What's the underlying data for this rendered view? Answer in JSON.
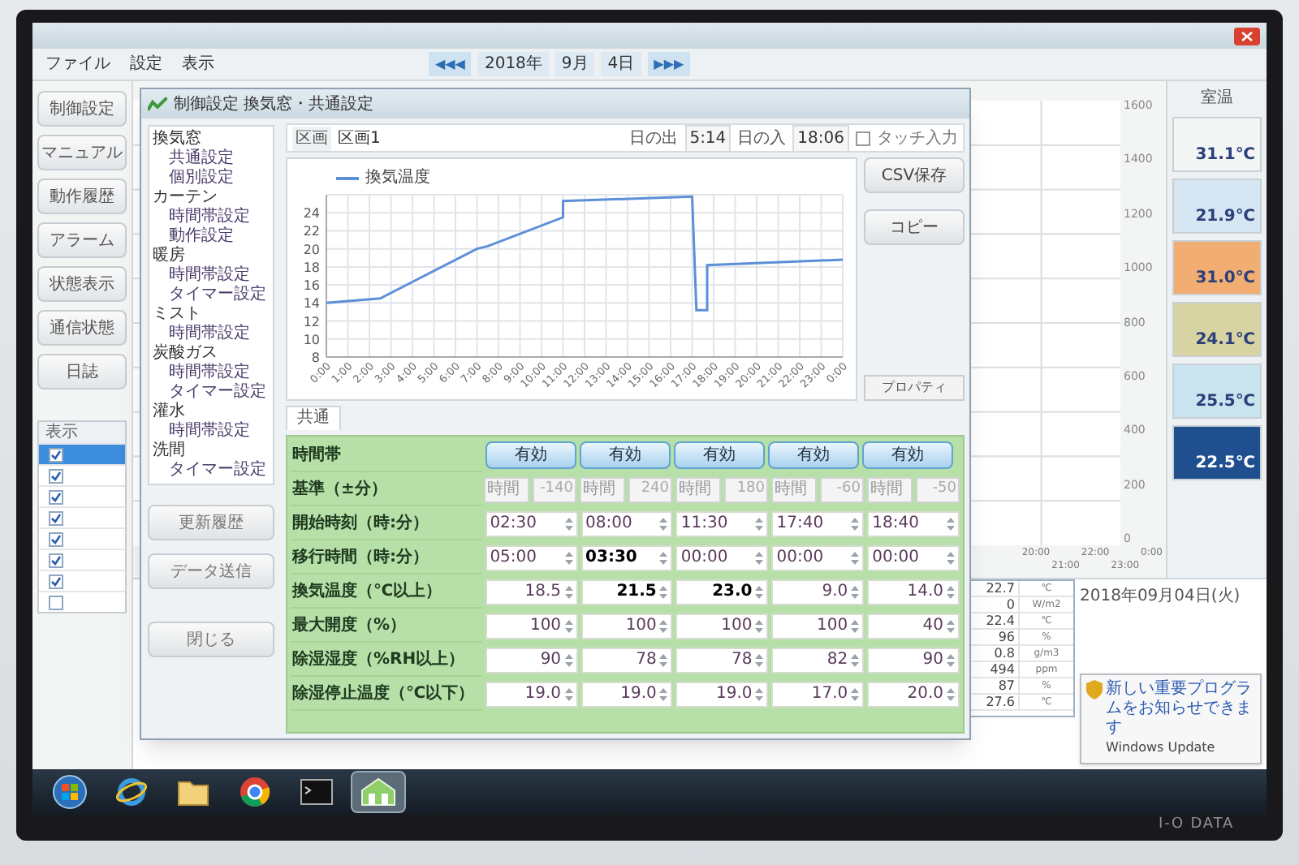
{
  "monitor": {
    "brand": "I-O DATA"
  },
  "app": {
    "menu": [
      "ファイル",
      "設定",
      "表示"
    ],
    "date_nav": {
      "prev": "◀◀◀",
      "year": "2018年",
      "month": "9月",
      "day": "4日",
      "next": "▶▶▶"
    },
    "nav_buttons": [
      "制御設定",
      "マニュアル",
      "動作履歴",
      "アラーム",
      "状態表示",
      "通信状態",
      "日誌"
    ],
    "display_list": {
      "header": "表示",
      "items": [
        {
          "checked": true,
          "selected": true
        },
        {
          "checked": true,
          "selected": false
        },
        {
          "checked": true,
          "selected": false
        },
        {
          "checked": true,
          "selected": false
        },
        {
          "checked": true,
          "selected": false
        },
        {
          "checked": true,
          "selected": false
        },
        {
          "checked": true,
          "selected": false
        },
        {
          "checked": false,
          "selected": false
        }
      ]
    },
    "trend_axis": {
      "y_labels": [
        "1600",
        "1400",
        "1200",
        "1000",
        "800",
        "600",
        "400",
        "200",
        "0"
      ],
      "x_labels": [
        "20:00",
        "21:00",
        "22:00",
        "23:00",
        "0:00"
      ]
    },
    "sensors": {
      "title": "室温",
      "items": [
        {
          "value": "31.1℃",
          "color": "#f4f6f6"
        },
        {
          "value": "21.9℃",
          "color": "#d6e6f3"
        },
        {
          "value": "31.0℃",
          "color": "#f2ae72"
        },
        {
          "value": "24.1℃",
          "color": "#d8d3a3"
        },
        {
          "value": "25.5℃",
          "color": "#c9e4ee"
        },
        {
          "value": "22.5℃",
          "color": "#1f4f8f"
        }
      ]
    },
    "readings": [
      {
        "value": "22.7",
        "unit": "℃"
      },
      {
        "value": "0",
        "unit": "W/m2"
      },
      {
        "value": "22.4",
        "unit": "℃"
      },
      {
        "value": "96",
        "unit": "%"
      },
      {
        "value": "0.8",
        "unit": "g/m3"
      },
      {
        "value": "494",
        "unit": "ppm"
      },
      {
        "value": "87",
        "unit": "%"
      },
      {
        "value": "27.6",
        "unit": "℃"
      }
    ],
    "log": {
      "date": "2018年09月04日(火)"
    },
    "notification": {
      "title": "新しい重要プログラムをお知らせできます",
      "body": "Windows Update"
    }
  },
  "dialog": {
    "title": "制御設定 換気窓・共通設定",
    "tree": [
      {
        "label": "換気窓",
        "children": [
          {
            "label": "共通設定"
          },
          {
            "label": "個別設定"
          }
        ]
      },
      {
        "label": "カーテン",
        "children": [
          {
            "label": "時間帯設定"
          },
          {
            "label": "動作設定"
          }
        ]
      },
      {
        "label": "暖房",
        "children": [
          {
            "label": "時間帯設定"
          },
          {
            "label": "タイマー設定"
          }
        ]
      },
      {
        "label": "ミスト",
        "children": [
          {
            "label": "時間帯設定"
          }
        ]
      },
      {
        "label": "炭酸ガス",
        "children": [
          {
            "label": "時間帯設定"
          },
          {
            "label": "タイマー設定"
          }
        ]
      },
      {
        "label": "灌水",
        "children": [
          {
            "label": "時間帯設定"
          }
        ]
      },
      {
        "label": "洗間",
        "children": [
          {
            "label": "タイマー設定"
          }
        ]
      }
    ],
    "side_buttons": [
      "更新履歴",
      "データ送信",
      "閉じる"
    ],
    "zone_label": "区画",
    "zone": "区画1",
    "sunrise_label": "日の出",
    "sunrise": "5:14",
    "sunset_label": "日の入",
    "sunset": "18:06",
    "touch_input": {
      "label": "タッチ入力",
      "checked": false
    },
    "buttons": [
      "CSV保存",
      "コピー"
    ],
    "chart_button": "プロパティ",
    "chart_data": {
      "type": "line",
      "x": [
        0,
        2.5,
        7,
        7.5,
        11,
        11,
        17,
        17.2,
        17.7,
        17.7,
        24
      ],
      "series": [
        {
          "name": "換気温度",
          "color": "#5b8fd8",
          "values": [
            14,
            14.5,
            20,
            20.3,
            23.5,
            25.3,
            25.8,
            13.2,
            13.2,
            18.2,
            18.8
          ]
        }
      ],
      "xlim": [
        0,
        24
      ],
      "ylim": [
        8,
        26
      ],
      "yticks": [
        8,
        10,
        12,
        14,
        16,
        18,
        20,
        22,
        24
      ],
      "xticks": [
        {
          "value": 0,
          "label": "0:00"
        },
        {
          "value": 1,
          "label": "1:00"
        },
        {
          "value": 2,
          "label": "2:00"
        },
        {
          "value": 3,
          "label": "3:00"
        },
        {
          "value": 4,
          "label": "4:00"
        },
        {
          "value": 5,
          "label": "5:00"
        },
        {
          "value": 6,
          "label": "6:00"
        },
        {
          "value": 7,
          "label": "7:00"
        },
        {
          "value": 8,
          "label": "8:00"
        },
        {
          "value": 9,
          "label": "9:00"
        },
        {
          "value": 10,
          "label": "10:00"
        },
        {
          "value": 11,
          "label": "11:00"
        },
        {
          "value": 12,
          "label": "12:00"
        },
        {
          "value": 13,
          "label": "13:00"
        },
        {
          "value": 14,
          "label": "14:00"
        },
        {
          "value": 15,
          "label": "15:00"
        },
        {
          "value": 16,
          "label": "16:00"
        },
        {
          "value": 17,
          "label": "17:00"
        },
        {
          "value": 18,
          "label": "18:00"
        },
        {
          "value": 19,
          "label": "19:00"
        },
        {
          "value": 20,
          "label": "20:00"
        },
        {
          "value": 21,
          "label": "21:00"
        },
        {
          "value": 22,
          "label": "22:00"
        },
        {
          "value": 23,
          "label": "23:00"
        },
        {
          "value": 24,
          "label": "0:00"
        }
      ],
      "grid": true
    },
    "tab": "共通",
    "rows": [
      {
        "label": "時間帯",
        "kind": "button",
        "cells": [
          {
            "value": "有効"
          },
          {
            "value": "有効"
          },
          {
            "value": "有効"
          },
          {
            "value": "有効"
          },
          {
            "value": "有効"
          }
        ]
      },
      {
        "label": "基準（±分）",
        "kind": "select",
        "cells": [
          {
            "unit": "時間",
            "value": "-140",
            "disabled": true
          },
          {
            "unit": "時間",
            "value": "240",
            "disabled": true
          },
          {
            "unit": "時間",
            "value": "180",
            "disabled": true
          },
          {
            "unit": "時間",
            "value": "-60",
            "disabled": true
          },
          {
            "unit": "時間",
            "value": "-50",
            "disabled": true
          }
        ]
      },
      {
        "label": "開始時刻（時:分）",
        "kind": "time",
        "cells": [
          {
            "value": "02:30",
            "bold": false
          },
          {
            "value": "08:00",
            "bold": false
          },
          {
            "value": "11:30",
            "bold": false
          },
          {
            "value": "17:40",
            "bold": false
          },
          {
            "value": "18:40",
            "bold": false
          }
        ]
      },
      {
        "label": "移行時間（時:分）",
        "kind": "time",
        "cells": [
          {
            "value": "05:00",
            "bold": false
          },
          {
            "value": "03:30",
            "bold": true
          },
          {
            "value": "00:00",
            "bold": false
          },
          {
            "value": "00:00",
            "bold": false
          },
          {
            "value": "00:00",
            "bold": false
          }
        ]
      },
      {
        "label": "換気温度（℃以上）",
        "kind": "number",
        "cells": [
          {
            "value": "18.5",
            "bold": false
          },
          {
            "value": "21.5",
            "bold": true
          },
          {
            "value": "23.0",
            "bold": true
          },
          {
            "value": "9.0",
            "bold": false
          },
          {
            "value": "14.0",
            "bold": false
          }
        ]
      },
      {
        "label": "最大開度（%）",
        "kind": "number",
        "cells": [
          {
            "value": "100",
            "bold": false
          },
          {
            "value": "100",
            "bold": false
          },
          {
            "value": "100",
            "bold": false
          },
          {
            "value": "100",
            "bold": false
          },
          {
            "value": "40",
            "bold": false
          }
        ]
      },
      {
        "label": "除湿湿度（%RH以上）",
        "kind": "number",
        "cells": [
          {
            "value": "90",
            "bold": false
          },
          {
            "value": "78",
            "bold": false
          },
          {
            "value": "78",
            "bold": false
          },
          {
            "value": "82",
            "bold": false
          },
          {
            "value": "90",
            "bold": false
          }
        ]
      },
      {
        "label": "除湿停止温度（℃以下）",
        "kind": "number",
        "cells": [
          {
            "value": "19.0",
            "bold": false
          },
          {
            "value": "19.0",
            "bold": false
          },
          {
            "value": "19.0",
            "bold": false
          },
          {
            "value": "17.0",
            "bold": false
          },
          {
            "value": "20.0",
            "bold": false
          }
        ]
      }
    ]
  },
  "taskbar": {
    "items": [
      {
        "kind": "start",
        "selected": false
      },
      {
        "kind": "browser",
        "selected": false
      },
      {
        "kind": "folder",
        "selected": false
      },
      {
        "kind": "chrome",
        "selected": false
      },
      {
        "kind": "terminal",
        "selected": false
      },
      {
        "kind": "app",
        "selected": true
      }
    ]
  }
}
